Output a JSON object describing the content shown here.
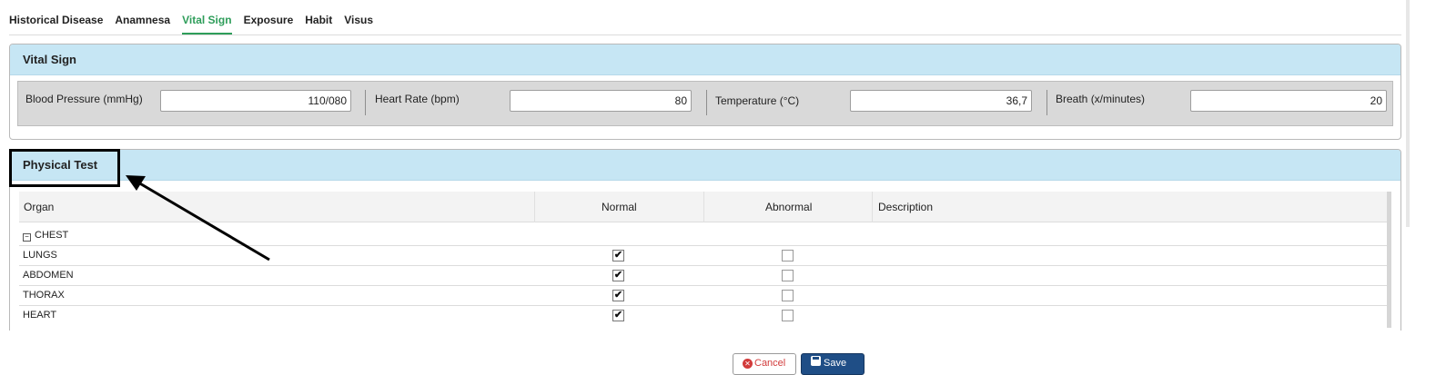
{
  "tabs": [
    {
      "label": "Historical Disease"
    },
    {
      "label": "Anamnesa"
    },
    {
      "label": "Vital Sign",
      "active": true
    },
    {
      "label": "Exposure"
    },
    {
      "label": "Habit"
    },
    {
      "label": "Visus"
    }
  ],
  "vital_sign": {
    "title": "Vital Sign",
    "fields": [
      {
        "label": "Blood Pressure (mmHg)",
        "value": "110/080"
      },
      {
        "label": "Heart Rate (bpm)",
        "value": "80"
      },
      {
        "label": "Temperature (°C)",
        "value": "36,7"
      },
      {
        "label": "Breath (x/minutes)",
        "value": "20"
      }
    ]
  },
  "physical_test": {
    "title": "Physical Test",
    "columns": {
      "organ": "Organ",
      "normal": "Normal",
      "abnormal": "Abnormal",
      "description": "Description"
    },
    "group": "CHEST",
    "rows": [
      {
        "organ": "LUNGS",
        "normal": true,
        "abnormal": false
      },
      {
        "organ": "ABDOMEN",
        "normal": true,
        "abnormal": false
      },
      {
        "organ": "THORAX",
        "normal": true,
        "abnormal": false
      },
      {
        "organ": "HEART",
        "normal": true,
        "abnormal": false
      }
    ]
  },
  "buttons": {
    "cancel": "Cancel",
    "save": "Save"
  },
  "colors": {
    "accent_tab": "#2e9d5a",
    "header_bg": "#c6e6f4",
    "save_bg": "#1f4e86",
    "cancel_icon": "#d23b3b"
  },
  "icons": {
    "collapse": "collapse-box-icon",
    "cancel": "cancel-circle-icon",
    "save": "floppy-disk-icon",
    "check": "check-icon"
  }
}
